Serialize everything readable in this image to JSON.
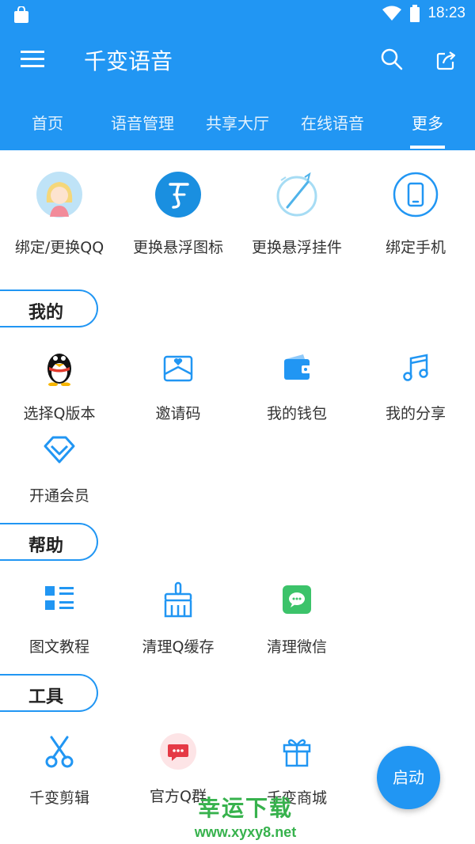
{
  "status_bar": {
    "time": "18:23"
  },
  "app_bar": {
    "title": "千变语音"
  },
  "tabs": [
    {
      "label": "首页"
    },
    {
      "label": "语音管理"
    },
    {
      "label": "共享大厅"
    },
    {
      "label": "在线语音"
    },
    {
      "label": "更多",
      "active": true
    }
  ],
  "top_items": [
    {
      "label": "绑定/更换QQ",
      "icon": "avatar-icon"
    },
    {
      "label": "更换悬浮图标",
      "icon": "float-logo-icon"
    },
    {
      "label": "更换悬浮挂件",
      "icon": "pendant-icon"
    },
    {
      "label": "绑定手机",
      "icon": "phone-icon"
    }
  ],
  "sections": {
    "mine": {
      "title": "我的",
      "items": [
        {
          "label": "选择Q版本",
          "icon": "qq-penguin-icon"
        },
        {
          "label": "邀请码",
          "icon": "invite-envelope-icon"
        },
        {
          "label": "我的钱包",
          "icon": "wallet-icon"
        },
        {
          "label": "我的分享",
          "icon": "music-note-icon"
        },
        {
          "label": "开通会员",
          "icon": "diamond-icon"
        }
      ]
    },
    "help": {
      "title": "帮助",
      "items": [
        {
          "label": "图文教程",
          "icon": "list-icon"
        },
        {
          "label": "清理Q缓存",
          "icon": "broom-icon"
        },
        {
          "label": "清理微信",
          "icon": "wechat-icon"
        }
      ]
    },
    "tools": {
      "title": "工具",
      "items": [
        {
          "label": "千变剪辑",
          "icon": "scissors-icon"
        },
        {
          "label": "官方Q群",
          "icon": "chat-bubble-icon"
        },
        {
          "label": "千变商城",
          "icon": "gift-icon"
        }
      ]
    }
  },
  "fab": {
    "label": "启动"
  },
  "watermark": {
    "line1": "幸运下载",
    "line2": "www.xyxy8.net"
  },
  "colors": {
    "primary": "#2196F3",
    "wechat": "#3CC36A",
    "penguin": "#111111"
  }
}
